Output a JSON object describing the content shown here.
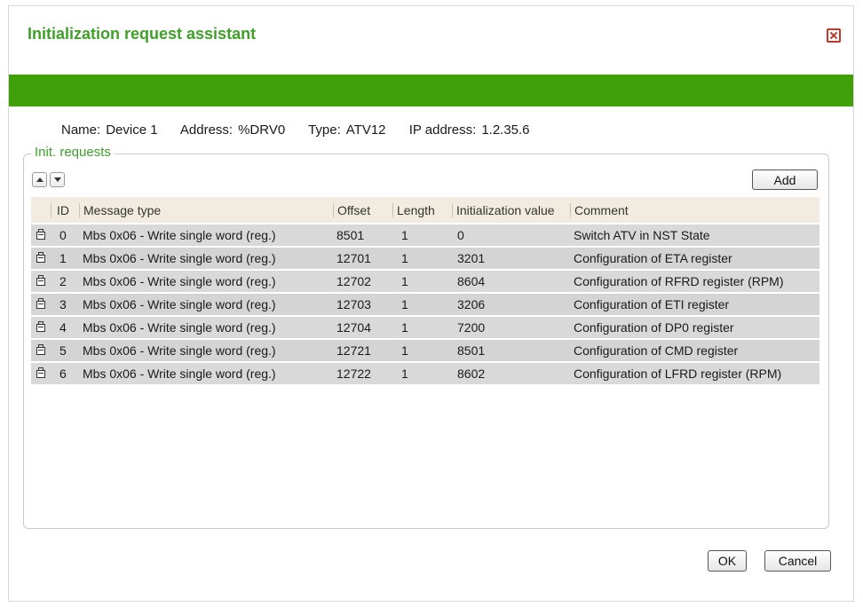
{
  "dialog": {
    "title": "Initialization request assistant",
    "accent_color": "#3fa00a",
    "close_icon": "close-icon"
  },
  "device": {
    "name_label": "Name:",
    "name_value": "Device 1",
    "address_label": "Address:",
    "address_value": "%DRV0",
    "type_label": "Type:",
    "type_value": "ATV12",
    "ip_label": "IP address:",
    "ip_value": "1.2.35.6"
  },
  "group": {
    "legend": "Init. requests",
    "add_label": "Add"
  },
  "table": {
    "headers": [
      "",
      "ID",
      "Message type",
      "Offset",
      "Length",
      "Initialization value",
      "Comment"
    ],
    "rows": [
      {
        "id": "0",
        "type": "Mbs 0x06 - Write single word (reg.)",
        "offset": "8501",
        "length": "1",
        "init": "0",
        "comment": "Switch ATV in NST State"
      },
      {
        "id": "1",
        "type": "Mbs 0x06 - Write single word (reg.)",
        "offset": "12701",
        "length": "1",
        "init": "3201",
        "comment": "Configuration of ETA register"
      },
      {
        "id": "2",
        "type": "Mbs 0x06 - Write single word (reg.)",
        "offset": "12702",
        "length": "1",
        "init": "8604",
        "comment": "Configuration of RFRD register (RPM)"
      },
      {
        "id": "3",
        "type": "Mbs 0x06 - Write single word (reg.)",
        "offset": "12703",
        "length": "1",
        "init": "3206",
        "comment": "Configuration of ETI register"
      },
      {
        "id": "4",
        "type": "Mbs 0x06 - Write single word (reg.)",
        "offset": "12704",
        "length": "1",
        "init": "7200",
        "comment": "Configuration of DP0 register"
      },
      {
        "id": "5",
        "type": "Mbs 0x06 - Write single word (reg.)",
        "offset": "12721",
        "length": "1",
        "init": "8501",
        "comment": "Configuration of CMD register"
      },
      {
        "id": "6",
        "type": "Mbs 0x06 - Write single word (reg.)",
        "offset": "12722",
        "length": "1",
        "init": "8602",
        "comment": "Configuration of LFRD register (RPM)"
      }
    ]
  },
  "footer": {
    "ok_label": "OK",
    "cancel_label": "Cancel"
  }
}
